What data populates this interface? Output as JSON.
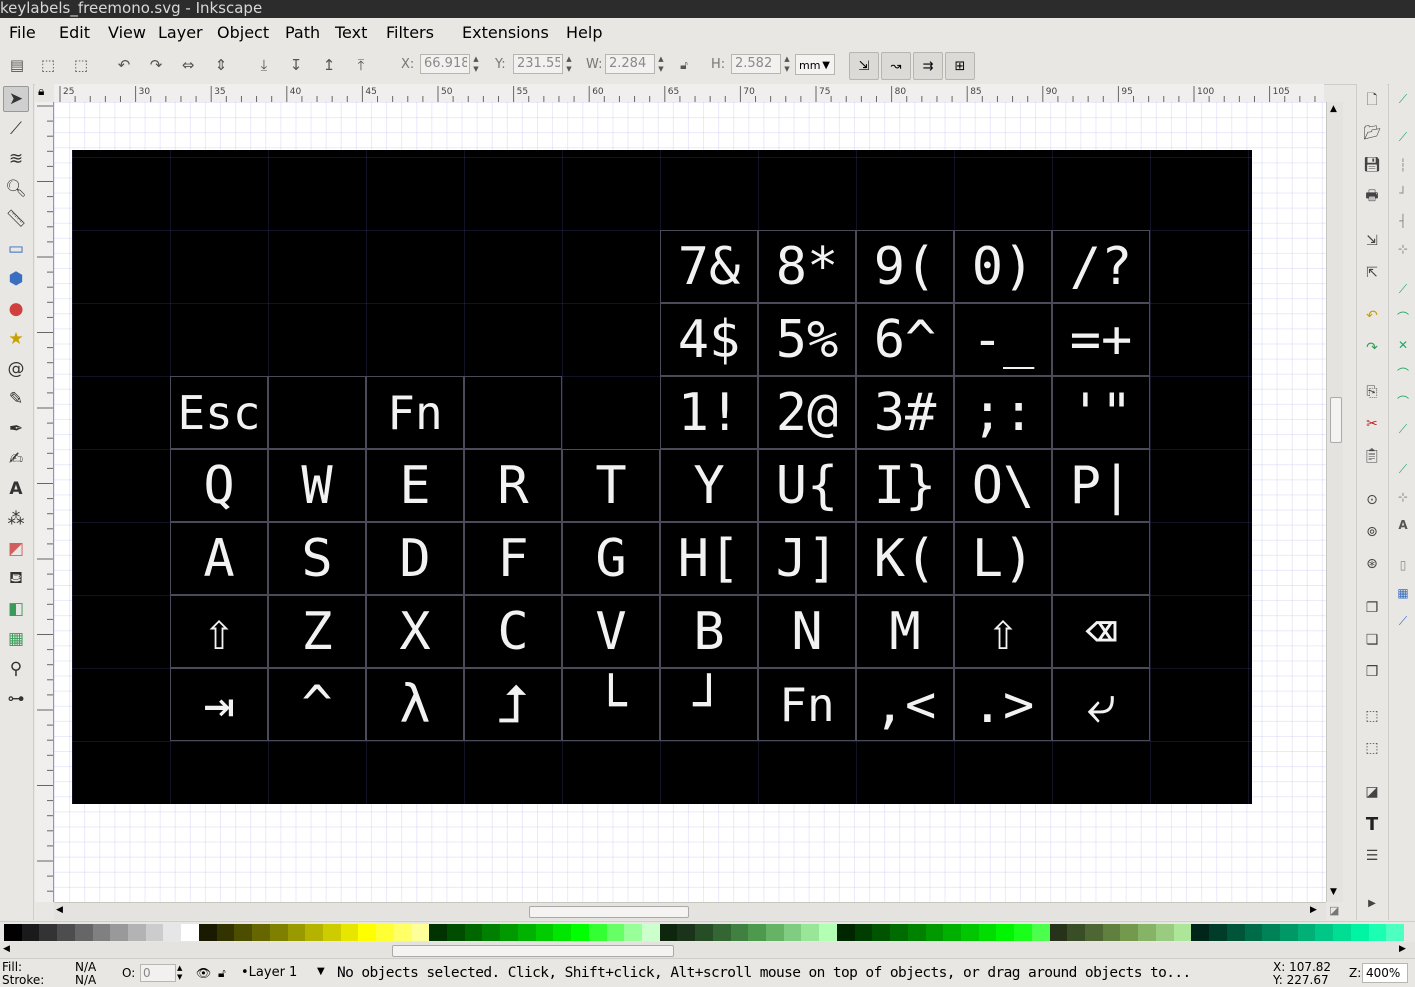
{
  "window": {
    "title": "keylabels_freemono.svg - Inkscape"
  },
  "menu": [
    "File",
    "Edit",
    "View",
    "Layer",
    "Object",
    "Path",
    "Text",
    "Filters",
    "Extensions",
    "Help"
  ],
  "toolbar": {
    "x_label": "X:",
    "x_value": "66.918",
    "y_label": "Y:",
    "y_value": "231.55",
    "w_label": "W:",
    "w_value": "2.284",
    "h_label": "H:",
    "h_value": "2.582",
    "unit": "mm"
  },
  "ruler_top_ticks": [
    "25",
    "30",
    "35",
    "40",
    "45",
    "50",
    "55",
    "60",
    "65",
    "70",
    "75",
    "80",
    "85",
    "90",
    "95",
    "100",
    "105"
  ],
  "keyboard": {
    "rows": [
      [
        null,
        null,
        null,
        null,
        null,
        "7&",
        "8*",
        "9(",
        "0)",
        "/?"
      ],
      [
        null,
        null,
        null,
        null,
        null,
        "4$",
        "5%",
        "6^",
        "-_",
        "=+"
      ],
      [
        "Esc",
        "",
        "Fn",
        "",
        null,
        "1!",
        "2@",
        "3#",
        ";:",
        "'\""
      ],
      [
        "Q",
        "W",
        "E",
        "R",
        "T",
        "Y",
        "U{",
        "I}",
        "O\\",
        "P|"
      ],
      [
        "A",
        "S",
        "D",
        "F",
        "G",
        "H[",
        "J]",
        "K(",
        "L)",
        ""
      ],
      [
        "⇧",
        "Z",
        "X",
        "C",
        "V",
        "B",
        "N",
        "M",
        "⇧",
        "⌫"
      ],
      [
        "⇥",
        "^",
        "λ",
        "⮥",
        "└",
        "┘",
        "Fn",
        ",<",
        ".>",
        "⤶"
      ]
    ]
  },
  "status": {
    "fill_label": "Fill:",
    "fill_value": "N/A",
    "stroke_label": "Stroke:",
    "stroke_value": "N/A",
    "opacity_label": "O:",
    "opacity_value": "0",
    "layer": "•Layer 1",
    "message": "No objects selected. Click, Shift+click, Alt+scroll mouse on top of objects, or drag around objects to...",
    "x_coord": "X: 107.82",
    "y_coord": "Y: 227.67",
    "zoom_label": "Z:",
    "zoom_value": "400%"
  },
  "colors": {
    "canvas_bg": "#ffffff",
    "page_bg": "#000000",
    "grid": "#3c3c60",
    "key_border": "#4a4a58",
    "label_color": "#f2f2f2"
  }
}
